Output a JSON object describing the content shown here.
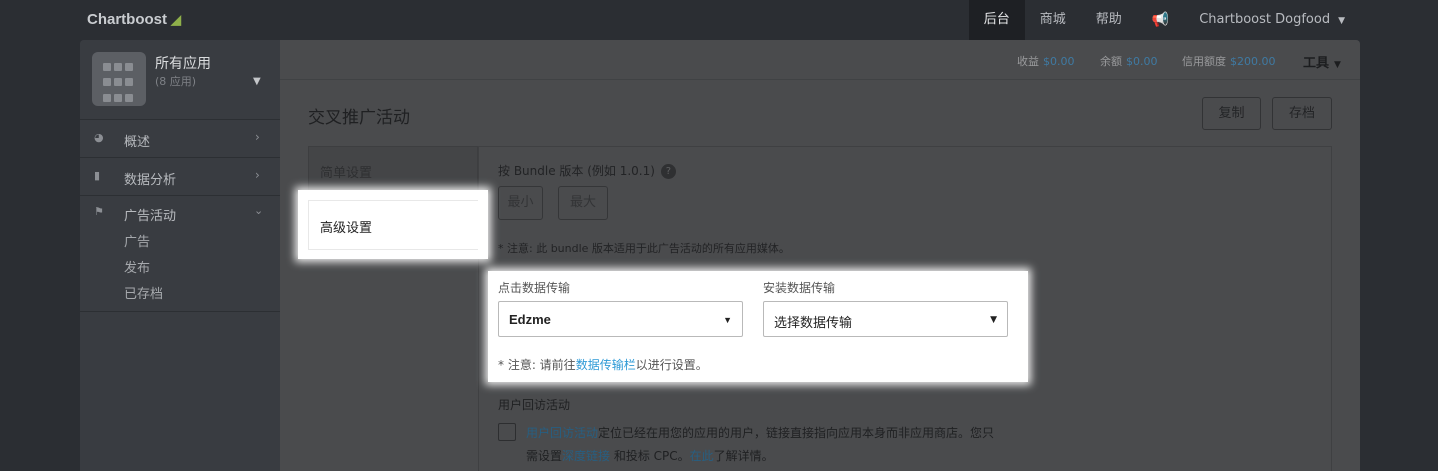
{
  "header": {
    "brand": "Chartboost",
    "nav": [
      {
        "label": "后台",
        "active": true
      },
      {
        "label": "商城"
      },
      {
        "label": "帮助"
      }
    ],
    "announcements_icon": "megaphone-icon",
    "account": "Chartboost Dogfood"
  },
  "sidebar": {
    "app_selector": {
      "name": "所有应用",
      "count": "(8 应用)"
    },
    "items": [
      {
        "label": "概述",
        "icon": "pie-chart-icon"
      },
      {
        "label": "数据分析",
        "icon": "bar-chart-icon"
      }
    ],
    "campaigns": {
      "label": "广告活动",
      "icon": "flag-icon",
      "sub_items": [
        "广告",
        "发布",
        "已存档"
      ]
    }
  },
  "statbar": {
    "earnings_label": "收益",
    "earnings": "$0.00",
    "balance_label": "余额",
    "balance": "$0.00",
    "credit_label": "信用额度",
    "credit": "$200.00",
    "tools": "工具"
  },
  "page": {
    "title": "交叉推广活动",
    "duplicate": "复制",
    "archive": "存档"
  },
  "tabs": {
    "simple": "简单设置",
    "advanced": "高级设置"
  },
  "bundle": {
    "label": "按 Bundle 版本 (例如 1.0.1)",
    "help": "?",
    "min_placeholder": "最小",
    "max_placeholder": "最大",
    "note": "* 注意: 此 bundle 版本适用于此广告活动的所有应用媒体。"
  },
  "data_transfer": {
    "click_label": "点击数据传输",
    "click_value": "Edzme",
    "install_label": "安装数据传输",
    "install_value": "选择数据传输",
    "note_prefix": "* 注意: 请前往",
    "note_link": "数据传输栏",
    "note_suffix": "以进行设置。"
  },
  "retargeting": {
    "title": "用户回访活动",
    "line1_link": "用户回访活动",
    "line1_text": "定位已经在用您的应用的用户，链接直接指向应用本身而非应用商店。您只",
    "line2_prefix": "需设置",
    "line2_link1": "深度链接",
    "line2_mid": " 和投标 CPC。",
    "line2_link2": "在此",
    "line2_suffix": "了解详情。"
  }
}
